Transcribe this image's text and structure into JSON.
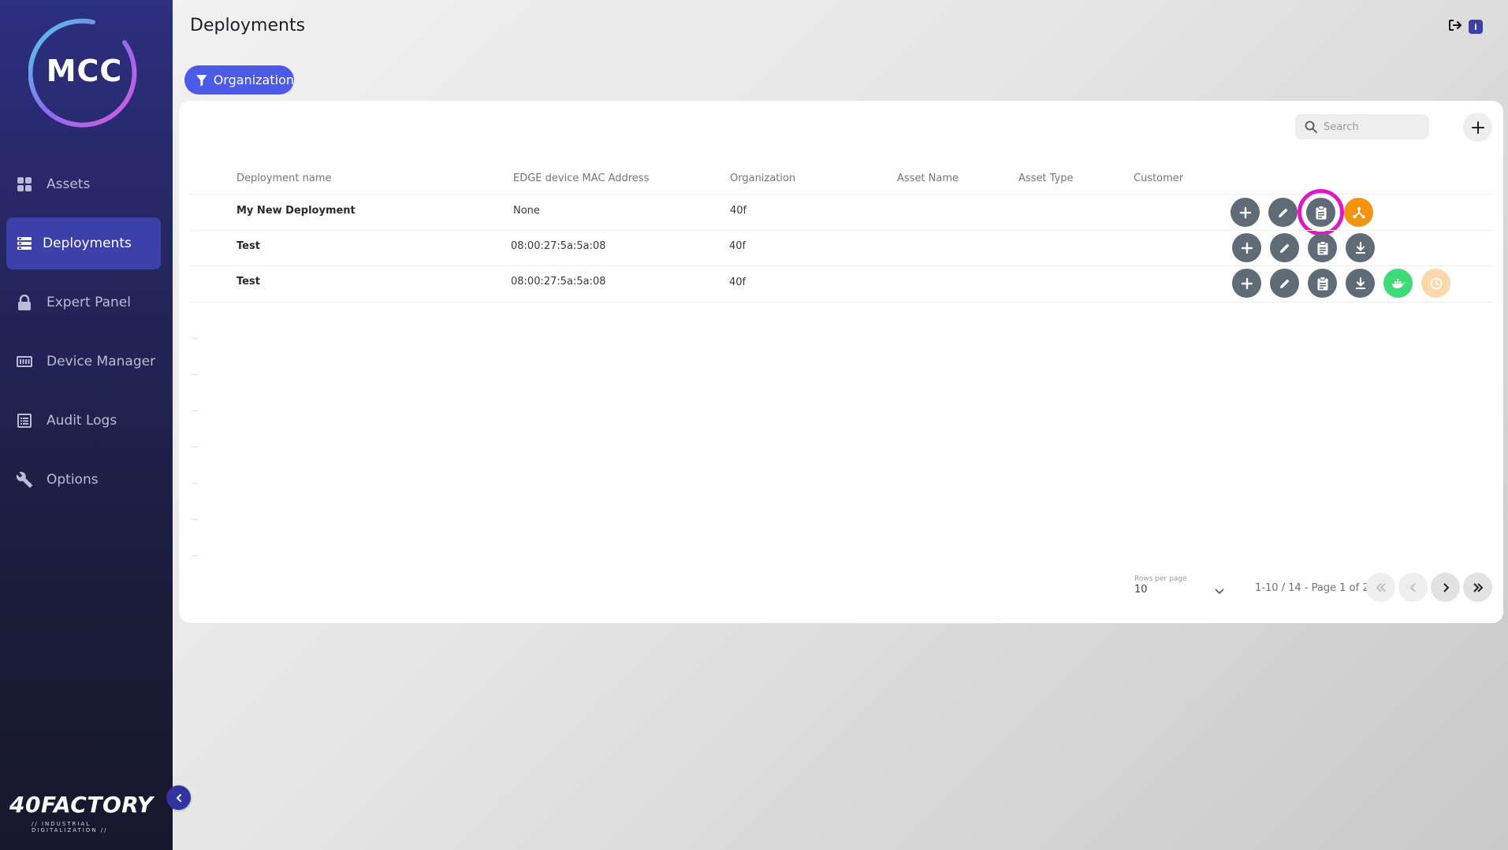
{
  "app": {
    "logo_text": "MCC",
    "brand_name": "40FACTORY",
    "brand_tagline": "// INDUSTRIAL DIGITALIZATION //"
  },
  "sidebar": {
    "items": [
      {
        "label": "Assets",
        "icon": "grid-icon",
        "active": false
      },
      {
        "label": "Deployments",
        "icon": "server-list-icon",
        "active": true
      },
      {
        "label": "Expert Panel",
        "icon": "lock-icon",
        "active": false
      },
      {
        "label": "Device Manager",
        "icon": "device-icon",
        "active": false
      },
      {
        "label": "Audit Logs",
        "icon": "list-icon",
        "active": false
      },
      {
        "label": "Options",
        "icon": "wrench-icon",
        "active": false
      }
    ]
  },
  "header": {
    "title": "Deployments",
    "info_badge": "i"
  },
  "filter": {
    "label": "Organization"
  },
  "search": {
    "placeholder": "Search"
  },
  "table": {
    "columns": [
      "Deployment name",
      "EDGE device MAC Address",
      "Organization",
      "Asset Name",
      "Asset Type",
      "Customer"
    ],
    "rows": [
      {
        "name": "My New Deployment",
        "mac": "None",
        "organization": "40f",
        "asset_name": "",
        "asset_type": "",
        "customer": "",
        "actions": [
          "add-icon",
          "edit-icon",
          "clipboard-icon",
          "network-icon"
        ]
      },
      {
        "name": "Test",
        "mac": "08:00:27:5a:5a:08",
        "organization": "40f",
        "asset_name": "",
        "asset_type": "",
        "customer": "",
        "actions": [
          "add-icon",
          "edit-icon",
          "clipboard-icon",
          "download-icon"
        ]
      },
      {
        "name": "Test",
        "mac": "08:00:27:5a:5a:08",
        "organization": "40f",
        "asset_name": "",
        "asset_type": "",
        "customer": "",
        "actions": [
          "add-icon",
          "edit-icon",
          "clipboard-icon",
          "download-icon",
          "docker-icon",
          "clock-icon"
        ]
      }
    ]
  },
  "pagination": {
    "rows_per_page_label": "Rows per page",
    "rows_per_page_value": "10",
    "info": "1-10 / 14 - Page 1 of 2"
  },
  "colors": {
    "accent": "#4c5ae8",
    "sidebar_active": "#3d40a8",
    "action_grey": "#5f6b76",
    "action_orange": "#f5920f",
    "action_green": "#3ddc78",
    "action_peach": "#fbd9ad",
    "highlight": "#e216c4"
  }
}
